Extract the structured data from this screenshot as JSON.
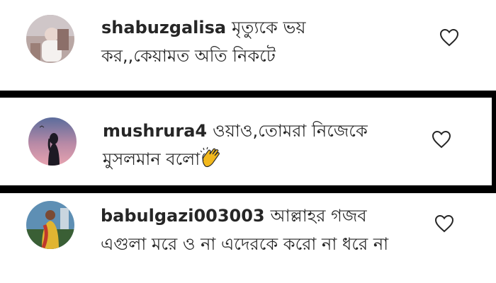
{
  "comments": [
    {
      "username": "shabuzgalisa",
      "text": "মৃত্যুকে ভয় কর,,কেয়ামত অতি নিকটে",
      "avatar_icon": "user-avatar-photo",
      "like_icon": "heart-outline-icon"
    },
    {
      "username": "mushrura4",
      "text": "ওয়াও,তোমরা নিজেকে মুসলমান বলো",
      "emoji": "clapping-hands-emoji",
      "avatar_icon": "user-avatar-photo",
      "like_icon": "heart-outline-icon"
    },
    {
      "username": "babulgazi003003",
      "text": "আল্লাহর গজব এগুলা মরে ও না এদেরকে করো না ধরে না",
      "avatar_icon": "user-avatar-photo",
      "like_icon": "heart-outline-icon"
    }
  ],
  "colors": {
    "text": "#262626",
    "background": "#ffffff",
    "separator": "#000000",
    "emoji": "#f2b81c"
  }
}
